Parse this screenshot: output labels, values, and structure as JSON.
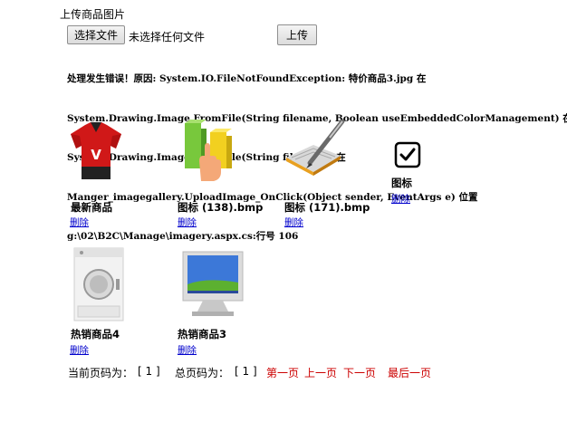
{
  "upload": {
    "title": "上传商品图片",
    "choose_label": "选择文件",
    "no_file_text": "未选择任何文件",
    "upload_label": "上传"
  },
  "error": {
    "lines": [
      "处理发生错误！原因: System.IO.FileNotFoundException: 特价商品3.jpg 在",
      "System.Drawing.Image.FromFile(String filename, Boolean useEmbeddedColorManagement) 在",
      "System.Drawing.Image.FromFile(String filename) 在",
      "Manger_imagegallery.UploadImage_OnClick(Object sender, EventArgs e) 位置",
      "g:\\02\\B2C\\Manage\\imagery.aspx.cs:行号 106"
    ]
  },
  "gallery": [
    {
      "name": "最新商品",
      "delete": "删除",
      "icon": "red-polo-shirt-icon"
    },
    {
      "name": "图标 (138).bmp",
      "delete": "删除",
      "icon": "blocks-hand-icon"
    },
    {
      "name": "图标 (171).bmp",
      "delete": "删除",
      "icon": "book-pen-icon"
    },
    {
      "name": "图标",
      "delete": "删除",
      "icon": "checkbox-icon"
    },
    {
      "name": "热销商品4",
      "delete": "删除",
      "icon": "washing-machine-icon"
    },
    {
      "name": "热销商品3",
      "delete": "删除",
      "icon": "monitor-icon"
    }
  ],
  "pager": {
    "current_label": "当前页码为：",
    "current_page": "[ 1 ]",
    "total_label": "总页码为：",
    "total_pages": "[ 1 ]",
    "first": "第一页",
    "prev": "上一页",
    "next": "下一页",
    "last": "最后一页"
  },
  "colors": {
    "link": "#0000cc",
    "pager_link": "#cc0000"
  }
}
